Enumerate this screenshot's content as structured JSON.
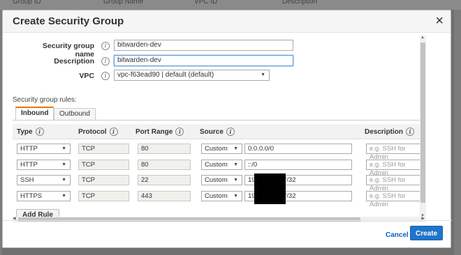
{
  "background_table": {
    "headers": [
      "Group ID",
      "Group Name",
      "VPC ID",
      "Description"
    ]
  },
  "dialog": {
    "title": "Create Security Group",
    "close_glyph": "×",
    "info_glyph": "i"
  },
  "form": {
    "name_label": "Security group name",
    "name_value": "bitwarden-dev",
    "description_label": "Description",
    "description_value": "bitwarden-dev",
    "vpc_label": "VPC",
    "vpc_value": "vpc-f63ead90 | default (default)"
  },
  "rules": {
    "caption": "Security group rules:",
    "tabs": [
      "Inbound",
      "Outbound"
    ],
    "active_tab": "Inbound",
    "columns": [
      "Type",
      "Protocol",
      "Port Range",
      "Source",
      "Description"
    ],
    "rows": [
      {
        "type": "HTTP",
        "protocol": "TCP",
        "port": "80",
        "source_type": "Custom",
        "source": "0.0.0.0/0",
        "description_placeholder": "e.g. SSH for Admin"
      },
      {
        "type": "HTTP",
        "protocol": "TCP",
        "port": "80",
        "source_type": "Custom",
        "source": "::/0",
        "description_placeholder": "e.g. SSH for Admin"
      },
      {
        "type": "SSH",
        "protocol": "TCP",
        "port": "22",
        "source_type": "Custom",
        "source": "194",
        "source_suffix": "7/32",
        "description_placeholder": "e.g. SSH for Admin"
      },
      {
        "type": "HTTPS",
        "protocol": "TCP",
        "port": "443",
        "source_type": "Custom",
        "source": "194",
        "source_suffix": "7/32",
        "description_placeholder": "e.g. SSH for Admin"
      }
    ],
    "add_rule_label": "Add Rule"
  },
  "footer": {
    "cancel_label": "Cancel",
    "create_label": "Create"
  },
  "colors": {
    "primary_button": "#1f75cb",
    "link": "#0066c0",
    "active_tab_accent": "#e77600"
  }
}
